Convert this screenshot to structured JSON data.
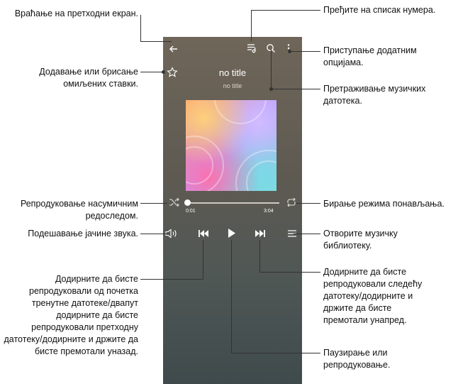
{
  "labels": {
    "back": "Враћање на претходни екран.",
    "favorites": "Додавање или брисање омиљених ставки.",
    "shuffle": "Репродуковање насумичним редоследом.",
    "volume": "Подешавање јачине звука.",
    "previous": "Додирните да бисте репродуковали од почетка тренутне датотеке/двапут додирните да бисте репродуковали претходну датотеку/додирните и држите да бисте премотали уназад.",
    "playlist": "Пређите на списак нумера.",
    "more": "Приступање додатним опцијама.",
    "search": "Претраживање музичких датотека.",
    "repeat": "Бирање режима понављања.",
    "library": "Отворите музичку библиотеку.",
    "next": "Додирните да бисте репродуковали следећу датотеку/додирните и држите да бисте премотали унапред.",
    "play": "Паузирање или репродуковање."
  },
  "player": {
    "title": "no title",
    "subtitle": "no title",
    "time_elapsed": "0:01",
    "time_total": "3:04",
    "progress": 0.005
  },
  "icons": {
    "back": "back-arrow-icon",
    "playlist": "playlist-icon",
    "search": "search-icon",
    "more": "more-vertical-icon",
    "favorite": "star-outline-icon",
    "shuffle": "shuffle-icon",
    "repeat": "repeat-icon",
    "volume": "volume-icon",
    "previous": "skip-previous-icon",
    "play": "play-icon",
    "next": "skip-next-icon",
    "library": "menu-icon"
  },
  "colors": {
    "screen_top": "#6f6659",
    "screen_bottom": "#3f4a4c",
    "callout_line": "#333333"
  }
}
